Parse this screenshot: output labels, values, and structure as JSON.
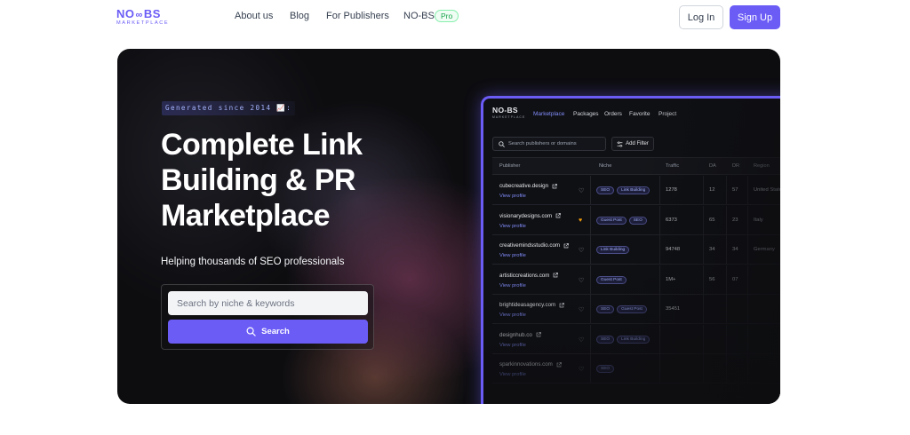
{
  "nav": {
    "logo_main_left": "NO",
    "logo_main_right": "BS",
    "logo_sub": "MARKETPLACE",
    "links": {
      "about": "About us",
      "blog": "Blog",
      "publishers": "For Publishers",
      "nobs": "NO-BS"
    },
    "pro_badge": "Pro",
    "login": "Log In",
    "signup": "Sign Up"
  },
  "hero": {
    "tag": "Generated since 2014 📈:",
    "title": "Complete Link Building & PR Marketplace",
    "subtitle": "Helping thousands of SEO professionals",
    "search_placeholder": "Search by niche & keywords",
    "search_button": "Search"
  },
  "dashboard": {
    "logo_main": "NO-BS",
    "logo_sub": "MARKETPLACE",
    "nav": [
      "Marketplace",
      "Packages",
      "Orders",
      "Favorite",
      "Project"
    ],
    "search_placeholder": "Search publishers or domains",
    "filter_label": "Add Filter",
    "headers": [
      "Publisher",
      "Niche",
      "Traffic",
      "DA",
      "DR",
      "Region"
    ],
    "view_label": "View profile",
    "rows": [
      {
        "domain": "cubecreative.design",
        "fav": false,
        "tags": [
          "SEO",
          "Link Building"
        ],
        "traffic": "1278",
        "da": "12",
        "dr": "57",
        "region": "United States"
      },
      {
        "domain": "visionarydesigns.com",
        "fav": true,
        "tags": [
          "Guest Post",
          "SEO"
        ],
        "traffic": "6373",
        "da": "65",
        "dr": "23",
        "region": "Italy"
      },
      {
        "domain": "creativemindsstudio.com",
        "fav": false,
        "tags": [
          "Link Building"
        ],
        "traffic": "94748",
        "da": "34",
        "dr": "34",
        "region": "Germany"
      },
      {
        "domain": "artisticcreations.com",
        "fav": false,
        "tags": [
          "Guest Post"
        ],
        "traffic": "1M+",
        "da": "56",
        "dr": "07",
        "region": ""
      },
      {
        "domain": "brightideasagency.com",
        "fav": false,
        "tags": [
          "SEO",
          "Guest Post"
        ],
        "traffic": "35451",
        "da": "",
        "dr": "",
        "region": ""
      },
      {
        "domain": "designhub.co",
        "fav": false,
        "tags": [
          "SEO",
          "Link Building"
        ],
        "traffic": "",
        "da": "",
        "dr": "",
        "region": ""
      },
      {
        "domain": "sparkinnovations.com",
        "fav": false,
        "tags": [
          "SEO"
        ],
        "traffic": "",
        "da": "",
        "dr": "",
        "region": ""
      }
    ]
  }
}
